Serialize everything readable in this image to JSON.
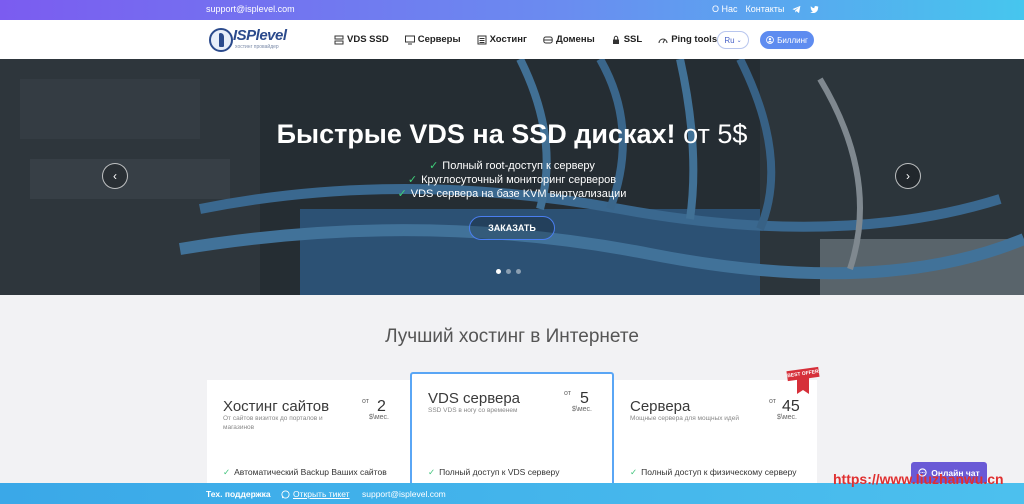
{
  "topbar": {
    "email": "support@isplevel.com",
    "links": [
      "О Нас",
      "Контакты"
    ],
    "social": [
      "telegram-icon",
      "twitter-icon"
    ]
  },
  "header": {
    "logo": {
      "brand": "ISPlevel",
      "tagline": "хостинг провайдер"
    },
    "nav": [
      {
        "label": "VDS SSD",
        "icon": "server-stack-icon"
      },
      {
        "label": "Серверы",
        "icon": "monitor-icon"
      },
      {
        "label": "Хостинг",
        "icon": "list-icon"
      },
      {
        "label": "Домены",
        "icon": "globe-icon"
      },
      {
        "label": "SSL",
        "icon": "lock-icon"
      },
      {
        "label": "Ping tools",
        "icon": "gauge-icon"
      }
    ],
    "lang": "Ru",
    "billing": "Биллинг"
  },
  "hero": {
    "title": "Быстрые VDS на SSD дисках!",
    "price": "от 5$",
    "features": [
      "Полный root-доступ к серверу",
      "Круглосуточный мониторинг серверов",
      "VDS сервера на базе KVM виртуализации"
    ],
    "order": "ЗАКАЗАТЬ",
    "slides": 3,
    "active_slide": 1
  },
  "section": {
    "title": "Лучший хостинг в Интернете"
  },
  "cards": [
    {
      "name": "Хостинг сайтов",
      "desc": "От сайтов визиток до порталов и магазинов",
      "ot": "от",
      "price": "2",
      "per": "$\\мес.",
      "feature": "Автоматический Backup Ваших сайтов"
    },
    {
      "name": "VDS сервера",
      "desc": "SSD VDS в ногу со временем",
      "ot": "от",
      "price": "5",
      "per": "$\\мес.",
      "feature": "Полный доступ к VDS серверу"
    },
    {
      "name": "Сервера",
      "desc": "Мощные сервера для мощных идей",
      "ot": "от",
      "price": "45",
      "per": "$\\мес.",
      "feature": "Полный доступ к физическому серверу"
    }
  ],
  "best_offer": "BEST OFFER",
  "support": {
    "label": "Тех. поддержка",
    "ticket": "Открыть тикет",
    "email": "support@isplevel.com"
  },
  "chat": "Онлайн чат",
  "watermark": "https://www.liuzhanwu.cn",
  "colors": {
    "accent": "#5e8cf0",
    "topbar_start": "#7b5cf0",
    "topbar_end": "#46c6ee",
    "check": "#3fd17a",
    "card_highlight": "#5aa6f5",
    "chat": "#6a5ad6"
  }
}
